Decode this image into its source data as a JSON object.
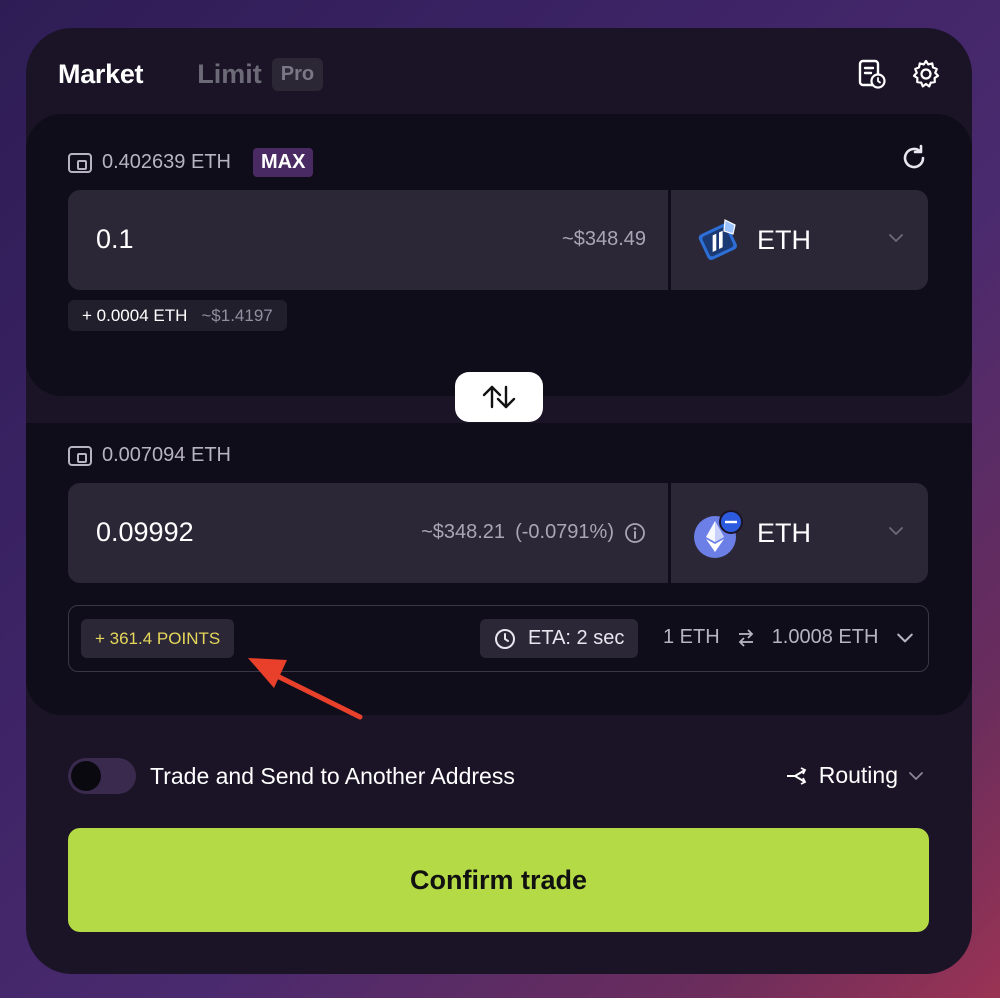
{
  "header": {
    "tab_market": "Market",
    "tab_limit": "Limit",
    "pro_badge": "Pro",
    "icons": [
      "history-icon",
      "settings-icon"
    ]
  },
  "from": {
    "balance": "0.402639 ETH",
    "max_label": "MAX",
    "amount": "0.1",
    "usd_value": "~$348.49",
    "token_symbol": "ETH",
    "fee_eth": "+ 0.0004 ETH",
    "fee_usd": "~$1.4197"
  },
  "to": {
    "balance": "0.007094 ETH",
    "amount": "0.09992",
    "usd_value": "~$348.21",
    "price_impact": "(-0.0791%)",
    "token_symbol": "ETH"
  },
  "info": {
    "points": "+ 361.4 POINTS",
    "eta": "ETA: 2 sec",
    "rate_from": "1 ETH",
    "rate_to": "1.0008 ETH"
  },
  "options": {
    "toggle_label": "Trade and Send to Another Address",
    "toggle_on": false,
    "routing_label": "Routing"
  },
  "confirm_label": "Confirm trade",
  "colors": {
    "accent": "#b4db45",
    "points": "#e6d75a",
    "max_bg": "#4a2a62",
    "annotation_arrow": "#e8402a"
  }
}
